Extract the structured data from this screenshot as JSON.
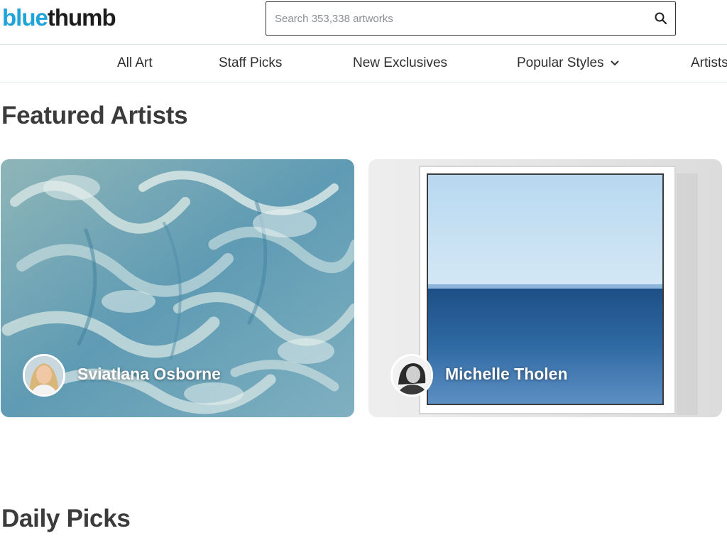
{
  "brand": {
    "part1": "blue",
    "part2": "thumb",
    "color_blue": "#1fa3d9",
    "color_dark": "#1c1c1c"
  },
  "search": {
    "placeholder": "Search 353,338 artworks",
    "icon": "search-icon"
  },
  "nav": {
    "items": [
      {
        "label": "All Art"
      },
      {
        "label": "Staff Picks"
      },
      {
        "label": "New Exclusives"
      },
      {
        "label": "Popular Styles",
        "icon": "chevron-down-icon"
      },
      {
        "label": "Artists"
      }
    ]
  },
  "featured": {
    "title": "Featured Artists",
    "artists": [
      {
        "name": "Sviatlana Osborne"
      },
      {
        "name": "Michelle Tholen"
      }
    ]
  },
  "daily": {
    "title": "Daily Picks"
  }
}
